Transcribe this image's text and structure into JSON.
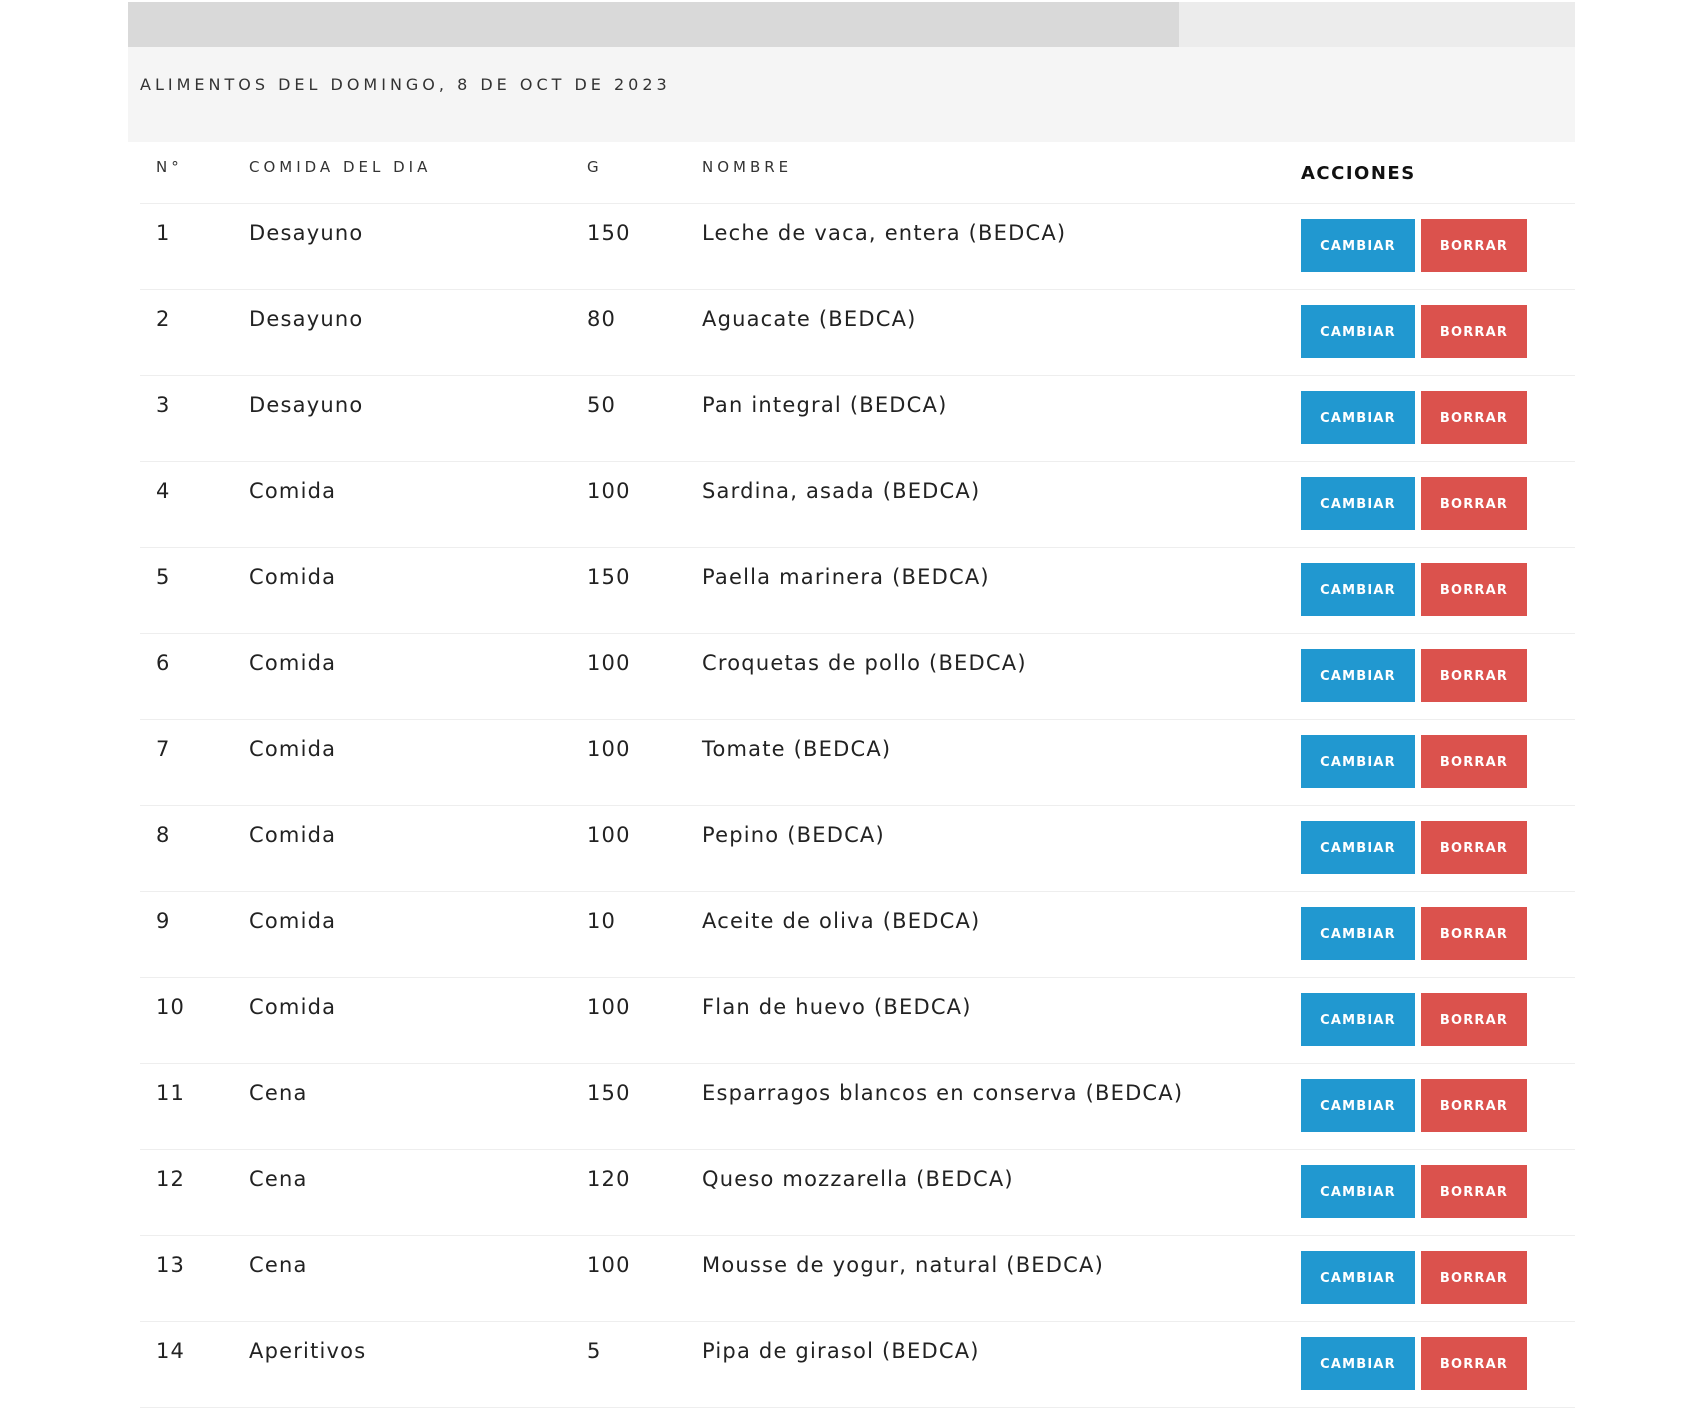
{
  "colors": {
    "edit_button": "#2198d0",
    "delete_button": "#db524d",
    "progress_fill": "#d9d9d9",
    "progress_track": "#ececec",
    "header_panel": "#f5f5f5"
  },
  "progress": {
    "fraction": 0.726
  },
  "header": {
    "title": "ALIMENTOS DEL DOMINGO, 8 DE OCT DE 2023"
  },
  "table": {
    "columns": [
      "N°",
      "COMIDA DEL DIA",
      "G",
      "NOMBRE",
      "ACCIONES"
    ],
    "edit_label": "CAMBIAR",
    "delete_label": "BORRAR",
    "rows": [
      {
        "no": "1",
        "meal": "Desayuno",
        "g": "150",
        "name": "Leche de vaca, entera (BEDCA)"
      },
      {
        "no": "2",
        "meal": "Desayuno",
        "g": "80",
        "name": "Aguacate (BEDCA)"
      },
      {
        "no": "3",
        "meal": "Desayuno",
        "g": "50",
        "name": "Pan integral (BEDCA)"
      },
      {
        "no": "4",
        "meal": "Comida",
        "g": "100",
        "name": "Sardina, asada (BEDCA)"
      },
      {
        "no": "5",
        "meal": "Comida",
        "g": "150",
        "name": "Paella marinera (BEDCA)"
      },
      {
        "no": "6",
        "meal": "Comida",
        "g": "100",
        "name": "Croquetas de pollo (BEDCA)"
      },
      {
        "no": "7",
        "meal": "Comida",
        "g": "100",
        "name": "Tomate (BEDCA)"
      },
      {
        "no": "8",
        "meal": "Comida",
        "g": "100",
        "name": "Pepino (BEDCA)"
      },
      {
        "no": "9",
        "meal": "Comida",
        "g": "10",
        "name": "Aceite de oliva (BEDCA)"
      },
      {
        "no": "10",
        "meal": "Comida",
        "g": "100",
        "name": "Flan de huevo (BEDCA)"
      },
      {
        "no": "11",
        "meal": "Cena",
        "g": "150",
        "name": "Esparragos blancos en conserva (BEDCA)"
      },
      {
        "no": "12",
        "meal": "Cena",
        "g": "120",
        "name": "Queso mozzarella (BEDCA)"
      },
      {
        "no": "13",
        "meal": "Cena",
        "g": "100",
        "name": "Mousse de yogur, natural (BEDCA)"
      },
      {
        "no": "14",
        "meal": "Aperitivos",
        "g": "5",
        "name": "Pipa de girasol (BEDCA)"
      }
    ]
  }
}
